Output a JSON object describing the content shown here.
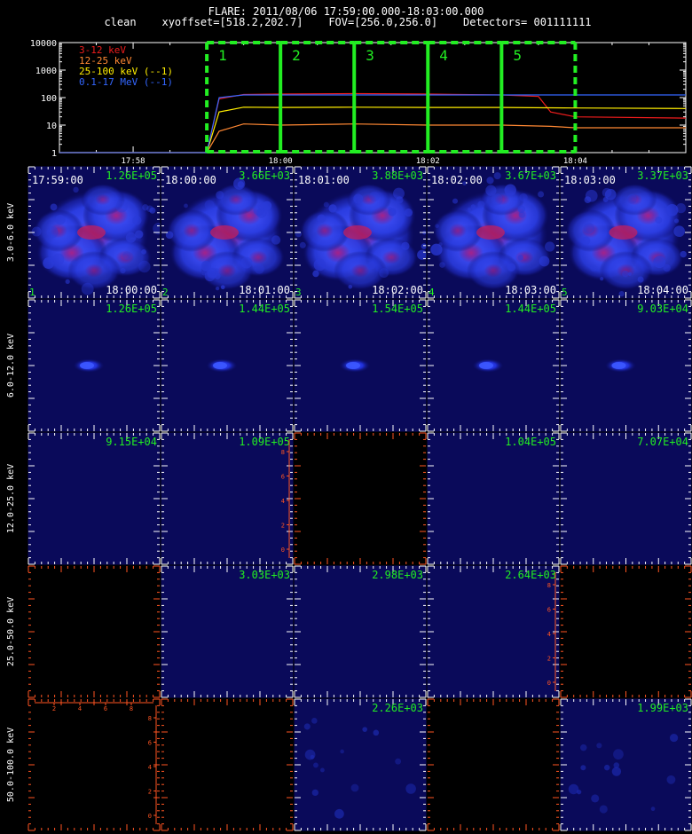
{
  "header": {
    "title": "FLARE: 2011/08/06 17:59:00.000-18:03:00.000",
    "subtitle": "clean    xyoffset=[518.2,202.7]    FOV=[256.0,256.0]    Detectors= 001111111"
  },
  "colors": {
    "background": "#000000",
    "green": "#22ee22",
    "band_3_12": "#ee1c1c",
    "band_12_25": "#ff8833",
    "band_25_100": "#ffee00",
    "band_01_17": "#3366ff",
    "tick_white": "#ffffff",
    "tick_orange": "#ff5522",
    "image_blue": "#0a0a5a"
  },
  "chart_data": [
    {
      "type": "line",
      "ylog": true,
      "ylim": [
        1,
        10000
      ],
      "y_ticks": [
        "10000",
        "1000",
        "100",
        "10",
        "1"
      ],
      "xlim": [
        "17:57:00",
        "18:05:30"
      ],
      "x_ticks": [
        "17:58",
        "18:00",
        "18:02",
        "18:04"
      ],
      "legend": [
        {
          "label": "3-12 keV",
          "color": "#ee1c1c"
        },
        {
          "label": "12-25 keV",
          "color": "#ff8833"
        },
        {
          "label": "25-100 keV (--1)",
          "color": "#ffee00"
        },
        {
          "label": "0.1-17 MeV (--1)",
          "color": "#3366ff"
        }
      ],
      "series": [
        {
          "color": "#ee1c1c",
          "x": [
            "17:57:00",
            "17:59:00",
            "17:59:10",
            "17:59:30",
            "18:00:00",
            "18:01:00",
            "18:02:00",
            "18:03:00",
            "18:03:30",
            "18:03:40",
            "18:04:00",
            "18:05:30"
          ],
          "y": [
            1,
            1,
            90,
            130,
            135,
            140,
            135,
            125,
            110,
            30,
            20,
            18
          ]
        },
        {
          "color": "#ff8833",
          "x": [
            "17:57:00",
            "17:59:00",
            "17:59:10",
            "17:59:30",
            "18:00:00",
            "18:01:00",
            "18:02:00",
            "18:03:00",
            "18:03:40",
            "18:04:00",
            "18:05:30"
          ],
          "y": [
            1,
            1,
            6,
            11,
            10,
            11,
            10,
            10,
            9,
            8,
            8
          ]
        },
        {
          "color": "#ffee00",
          "x": [
            "17:57:00",
            "17:59:00",
            "17:59:10",
            "17:59:30",
            "18:00:00",
            "18:01:00",
            "18:02:00",
            "18:03:00",
            "18:04:00",
            "18:05:30"
          ],
          "y": [
            1,
            1,
            30,
            45,
            44,
            45,
            44,
            44,
            42,
            40
          ]
        },
        {
          "color": "#3366ff",
          "x": [
            "17:57:00",
            "17:59:00",
            "17:59:10",
            "17:59:30",
            "18:05:30"
          ],
          "y": [
            1,
            1,
            100,
            125,
            125
          ]
        }
      ],
      "intervals": [
        {
          "label": "1",
          "start": "17:59:00",
          "end": "18:00:00"
        },
        {
          "label": "2",
          "start": "18:00:00",
          "end": "18:01:00"
        },
        {
          "label": "3",
          "start": "18:01:00",
          "end": "18:02:00"
        },
        {
          "label": "4",
          "start": "18:02:00",
          "end": "18:03:00"
        },
        {
          "label": "5",
          "start": "18:03:00",
          "end": "18:04:00"
        }
      ]
    },
    {
      "type": "heatmap",
      "energy_bands": [
        "3.0-6.0 keV",
        "6.0-12.0 keV",
        "12.0-25.0 keV",
        "25.0-50.0 keV",
        "50.0-100.0 keV"
      ],
      "column_start_times": [
        "17:59:00",
        "18:00:00",
        "18:01:00",
        "18:02:00",
        "18:03:00"
      ],
      "column_end_times": [
        "18:00:00",
        "18:01:00",
        "18:02:00",
        "18:03:00",
        "18:04:00"
      ],
      "column_numbers": [
        "1",
        "2",
        "3",
        "4",
        "5"
      ],
      "peak_values": [
        [
          "1.26E+05",
          "3.66E+03",
          "3.88E+03",
          "3.67E+03",
          "3.37E+03"
        ],
        [
          "1.26E+05",
          "1.44E+05",
          "1.54E+05",
          "1.44E+05",
          "9.03E+04"
        ],
        [
          "9.15E+04",
          "1.09E+05",
          "",
          "1.04E+05",
          "7.07E+04"
        ],
        [
          "",
          "3.03E+03",
          "2.98E+03",
          "2.64E+03",
          ""
        ],
        [
          "",
          "",
          "2.26E+03",
          "",
          "1.99E+03"
        ]
      ],
      "cell_kind": [
        [
          "bright",
          "bright",
          "bright",
          "bright",
          "bright"
        ],
        [
          "dim",
          "dim",
          "dim",
          "dim",
          "dim"
        ],
        [
          "empty",
          "empty",
          "none",
          "empty",
          "empty"
        ],
        [
          "none",
          "empty",
          "empty",
          "empty",
          "none"
        ],
        [
          "none",
          "none",
          "speckle",
          "none",
          "speckle"
        ]
      ],
      "axis_cells": [
        {
          "row": 2,
          "col": 1,
          "side": "right",
          "ticks": [
            "0",
            "2",
            "4",
            "6",
            "8"
          ]
        },
        {
          "row": 3,
          "col": 3,
          "side": "right",
          "ticks": [
            "0",
            "2",
            "4",
            "6",
            "8"
          ]
        },
        {
          "row": 4,
          "col": 0,
          "side": "right",
          "ticks": [
            "0",
            "2",
            "4",
            "6",
            "8"
          ]
        },
        {
          "row": 4,
          "col": 0,
          "side": "top",
          "ticks": [
            "2",
            "4",
            "6",
            "8"
          ]
        }
      ]
    }
  ]
}
